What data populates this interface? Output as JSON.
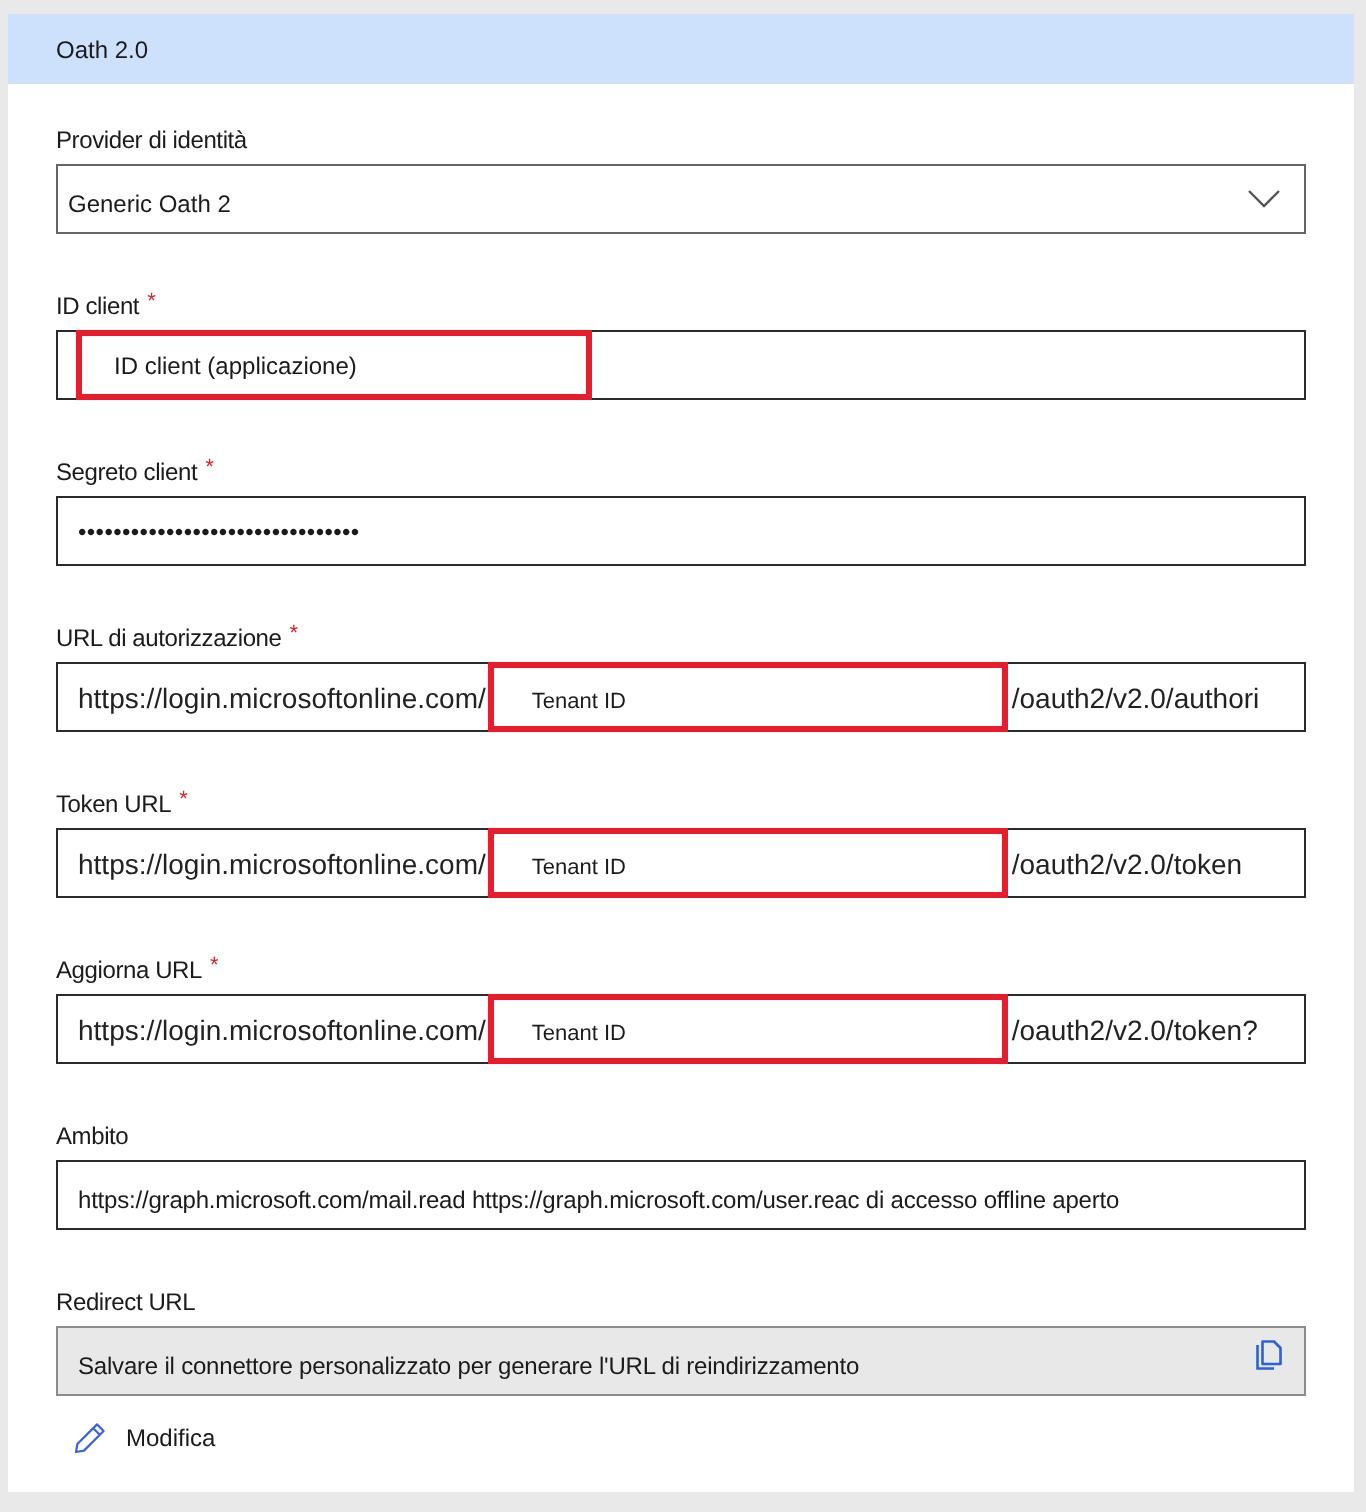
{
  "section": {
    "title": "Oath 2.0"
  },
  "required_mark": "*",
  "fields": [
    {
      "kind": "dropdown",
      "label": "Provider di identità",
      "required": false,
      "value": "Generic Oath 2"
    },
    {
      "kind": "annotated",
      "label": "ID client",
      "required": true,
      "annotation": "ID client (applicazione)"
    },
    {
      "kind": "secret",
      "label": "Segreto client",
      "required": true,
      "value": "••••••••••••••••••••••••••••••••"
    },
    {
      "kind": "url",
      "label": "URL di autorizzazione",
      "required": true,
      "prefix": "https://login.microsoftonline.com/",
      "annotation": "Tenant ID",
      "suffix": "/oauth2/v2.0/authori"
    },
    {
      "kind": "url",
      "label": "Token URL",
      "required": true,
      "prefix": "https://login.microsoftonline.com/",
      "annotation": "Tenant ID",
      "suffix": "/oauth2/v2.0/token"
    },
    {
      "kind": "url",
      "label": "Aggiorna URL",
      "required": true,
      "prefix": "https://login.microsoftonline.com/",
      "annotation": "Tenant ID",
      "suffix": "/oauth2/v2.0/token?"
    },
    {
      "kind": "text",
      "label": "Ambito",
      "required": false,
      "value": "https://graph.microsoft.com/mail.read https://graph.microsoft.com/user.reac di accesso offline aperto"
    },
    {
      "kind": "readonly",
      "label": "Redirect URL",
      "required": false,
      "value": "Salvare il connettore personalizzato per generare l'URL di reindirizzamento"
    }
  ],
  "edit_link": {
    "label": "Modifica"
  }
}
